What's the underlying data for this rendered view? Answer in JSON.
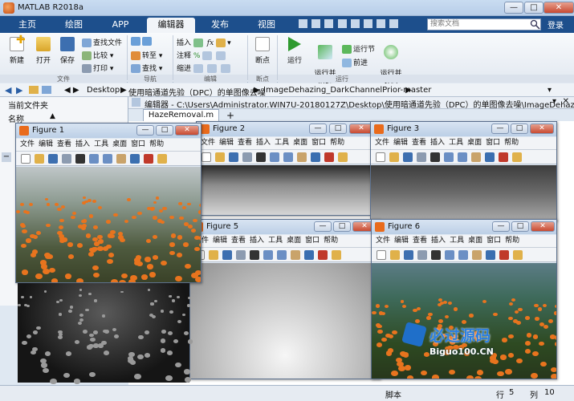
{
  "window": {
    "title": "MATLAB R2018a",
    "min": "—",
    "max": "□",
    "close": "✕"
  },
  "tabs": [
    {
      "label": "主页"
    },
    {
      "label": "绘图"
    },
    {
      "label": "APP"
    },
    {
      "label": "编辑器"
    },
    {
      "label": "发布"
    },
    {
      "label": "视图"
    }
  ],
  "search": {
    "placeholder": "搜索文档",
    "login": "登录"
  },
  "ribbon": {
    "file": {
      "new": "新建",
      "open": "打开",
      "save": "保存",
      "find_files": "查找文件",
      "compare": "比较",
      "print": "打印",
      "group": "文件"
    },
    "navigate": {
      "goto": "转至",
      "find": "查找",
      "group": "导航"
    },
    "edit": {
      "insert": "插入",
      "comment": "注释",
      "indent": "缩进",
      "group": "编辑"
    },
    "breakpoints": {
      "label": "断点",
      "group": "断点"
    },
    "run": {
      "run": "运行",
      "run_advance": "运行并\n前进",
      "run_section": "运行节",
      "advance": "前进",
      "run_time": "运行并\n计时",
      "group": "运行"
    }
  },
  "address": {
    "path": [
      "Desktop",
      "使用暗通道先验（DPC）的单图像去噪",
      "ImageDehazing_DarkChannelPrior-master"
    ]
  },
  "left_panel": {
    "title": "当前文件夹",
    "col": "名称"
  },
  "editor": {
    "title": "编辑器 - C:\\Users\\Administrator.WIN7U-20180127Z\\Desktop\\使用暗通道先验（DPC）的单图像去噪\\ImageDehazin...",
    "tab": "HazeRemoval.m",
    "plus": "+"
  },
  "status": {
    "script": "脚本",
    "row_label": "行",
    "row": "5",
    "col_label": "列",
    "col": "10"
  },
  "figure_menu": [
    "文件",
    "编辑",
    "查看",
    "插入",
    "工具",
    "桌面",
    "窗口",
    "帮助"
  ],
  "figures": [
    {
      "title": "Figure 1"
    },
    {
      "title": "Figure 2"
    },
    {
      "title": "Figure 3"
    },
    {
      "title": "Figure 5"
    },
    {
      "title": "Figure 6"
    }
  ],
  "watermark": {
    "cn": "必过源码",
    "en": "Biguo100.CN"
  }
}
